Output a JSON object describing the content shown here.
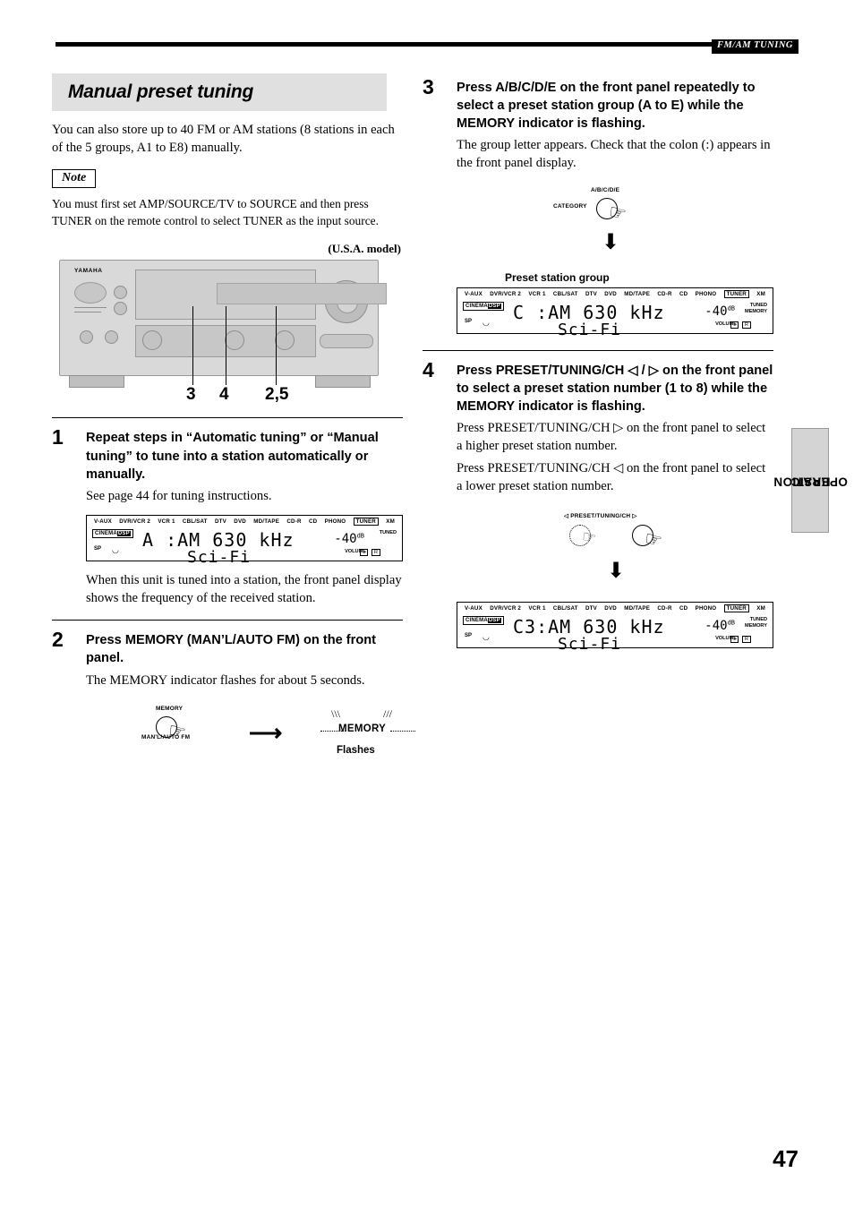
{
  "header": {
    "tag": "FM/AM TUNING"
  },
  "page_number": "47",
  "side_tab": {
    "line1": "BASIC",
    "line2": "OPERATION"
  },
  "left": {
    "title": "Manual preset tuning",
    "intro": "You can also store up to 40 FM or AM stations (8 stations in each of the 5 groups, A1 to E8) manually.",
    "note_label": "Note",
    "note_body": "You must first set AMP/SOURCE/TV to SOURCE and then press TUNER on the remote control to select TUNER as the input source.",
    "model_caption": "(U.S.A. model)",
    "receiver": {
      "brand": "YAMAHA",
      "callouts": [
        "3",
        "4",
        "2,5"
      ]
    },
    "steps": [
      {
        "num": "1",
        "head": "Repeat steps in “Automatic tuning” or “Manual tuning” to tune into a station automatically or manually.",
        "body": "See page 44 for tuning instructions.",
        "after": "When this unit is tuned into a station, the front panel display shows the frequency of the received station."
      },
      {
        "num": "2",
        "head": "Press MEMORY (MAN’L/AUTO FM) on the front panel.",
        "body": "The MEMORY indicator flashes for about 5 seconds."
      }
    ],
    "memory_graphic": {
      "button_label": "MEMORY",
      "button_sub": "MAN'L/AUTO FM",
      "indicator_label": "MEMORY",
      "flashes_caption": "Flashes"
    },
    "display1": {
      "input_labels": [
        "V-AUX",
        "DVR/VCR 2",
        "VCR 1",
        "CBL/SAT",
        "DTV",
        "DVD",
        "MD/TAPE",
        "CD-R",
        "CD",
        "PHONO",
        "TUNER",
        "XM"
      ],
      "selected_input": "TUNER",
      "cinema_badge": "CINEMA DSP",
      "main_text": "A :AM  630 kHz",
      "sub_text": "Sci-Fi",
      "volume": "-40",
      "volume_unit": "dB",
      "volume_label": "VOLUME",
      "sp_label": "SP",
      "tuned_label": "TUNED",
      "memory_label": "",
      "small_boxes": [
        "L",
        "R"
      ]
    }
  },
  "right": {
    "steps": [
      {
        "num": "3",
        "head": "Press A/B/C/D/E on the front panel repeatedly to select a preset station group (A to E) while the MEMORY indicator is flashing.",
        "body": "The group letter appears. Check that the colon (:) appears in the front panel display."
      },
      {
        "num": "4",
        "head": "Press PRESET/TUNING/CH ◁ / ▷ on the front panel to select a preset station number (1 to 8) while the MEMORY indicator is flashing.",
        "body1": "Press PRESET/TUNING/CH ▷ on the front panel to select a higher preset station number.",
        "body2": "Press PRESET/TUNING/CH ◁ on the front panel to select a lower preset station number."
      }
    ],
    "abcde_graphic": {
      "top_label": "A/B/C/D/E",
      "left_label": "CATEGORY"
    },
    "preset_caption": "Preset station group",
    "display2": {
      "input_labels": [
        "V-AUX",
        "DVR/VCR 2",
        "VCR 1",
        "CBL/SAT",
        "DTV",
        "DVD",
        "MD/TAPE",
        "CD-R",
        "CD",
        "PHONO",
        "TUNER",
        "XM"
      ],
      "selected_input": "TUNER",
      "cinema_badge": "CINEMA DSP",
      "main_text": "C :AM  630 kHz",
      "sub_text": "Sci-Fi",
      "volume": "-40",
      "volume_unit": "dB",
      "volume_label": "VOLUME",
      "sp_label": "SP",
      "tuned_label": "TUNED",
      "memory_label": "MEMORY",
      "small_boxes": [
        "L",
        "R"
      ]
    },
    "preset_tuning_graphic": {
      "label": "◁ PRESET/TUNING/CH ▷"
    },
    "display3": {
      "input_labels": [
        "V-AUX",
        "DVR/VCR 2",
        "VCR 1",
        "CBL/SAT",
        "DTV",
        "DVD",
        "MD/TAPE",
        "CD-R",
        "CD",
        "PHONO",
        "TUNER",
        "XM"
      ],
      "selected_input": "TUNER",
      "cinema_badge": "CINEMA DSP",
      "main_text": "C3:AM  630 kHz",
      "sub_text": "Sci-Fi",
      "volume": "-40",
      "volume_unit": "dB",
      "volume_label": "VOLUME",
      "sp_label": "SP",
      "tuned_label": "TUNED",
      "memory_label": "MEMORY",
      "small_boxes": [
        "L",
        "R"
      ]
    }
  }
}
